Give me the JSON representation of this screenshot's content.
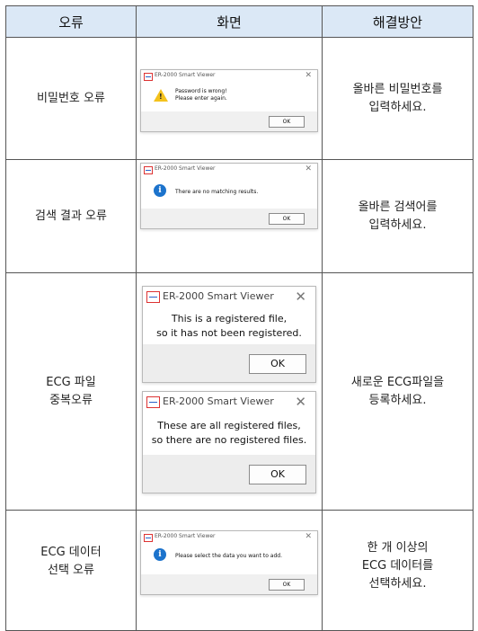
{
  "headers": {
    "error": "오류",
    "screen": "화면",
    "solution": "해결방안"
  },
  "rows": [
    {
      "error": "비밀번호 오류",
      "solution": "올바른 비밀번호를\n입력하세요.",
      "dialogs": [
        {
          "title": "ER-2000 Smart Viewer",
          "close": "✕",
          "icon": "warning-icon",
          "message": "Password is wrong!\nPlease enter again.",
          "ok": "OK"
        }
      ]
    },
    {
      "error": "검색 결과 오류",
      "solution": "올바른 검색어를\n입력하세요.",
      "dialogs": [
        {
          "title": "ER-2000 Smart Viewer",
          "close": "✕",
          "icon": "info-icon",
          "message": "There are no matching results.",
          "ok": "OK"
        }
      ]
    },
    {
      "error": "ECG 파일\n중복오류",
      "solution": "새로운 ECG파일을\n등록하세요.",
      "dialogs": [
        {
          "title": "ER-2000 Smart Viewer",
          "close": "✕",
          "icon": "",
          "message": "This is a registered file,\nso it has not been registered.",
          "ok": "OK"
        },
        {
          "title": "ER-2000 Smart Viewer",
          "close": "✕",
          "icon": "",
          "message": "These are all registered files,\nso there are no registered files.",
          "ok": "OK"
        }
      ]
    },
    {
      "error": "ECG 데이터\n선택 오류",
      "solution": "한 개 이상의\nECG 데이터를\n선택하세요.",
      "dialogs": [
        {
          "title": "ER-2000 Smart Viewer",
          "close": "✕",
          "icon": "info-icon",
          "message": "Please select the data you want to add.",
          "ok": "OK"
        }
      ]
    }
  ],
  "colors": {
    "header_bg": "#dbe8f6",
    "border": "#555555",
    "warning": "#f4c21c",
    "info": "#1c73cc"
  }
}
